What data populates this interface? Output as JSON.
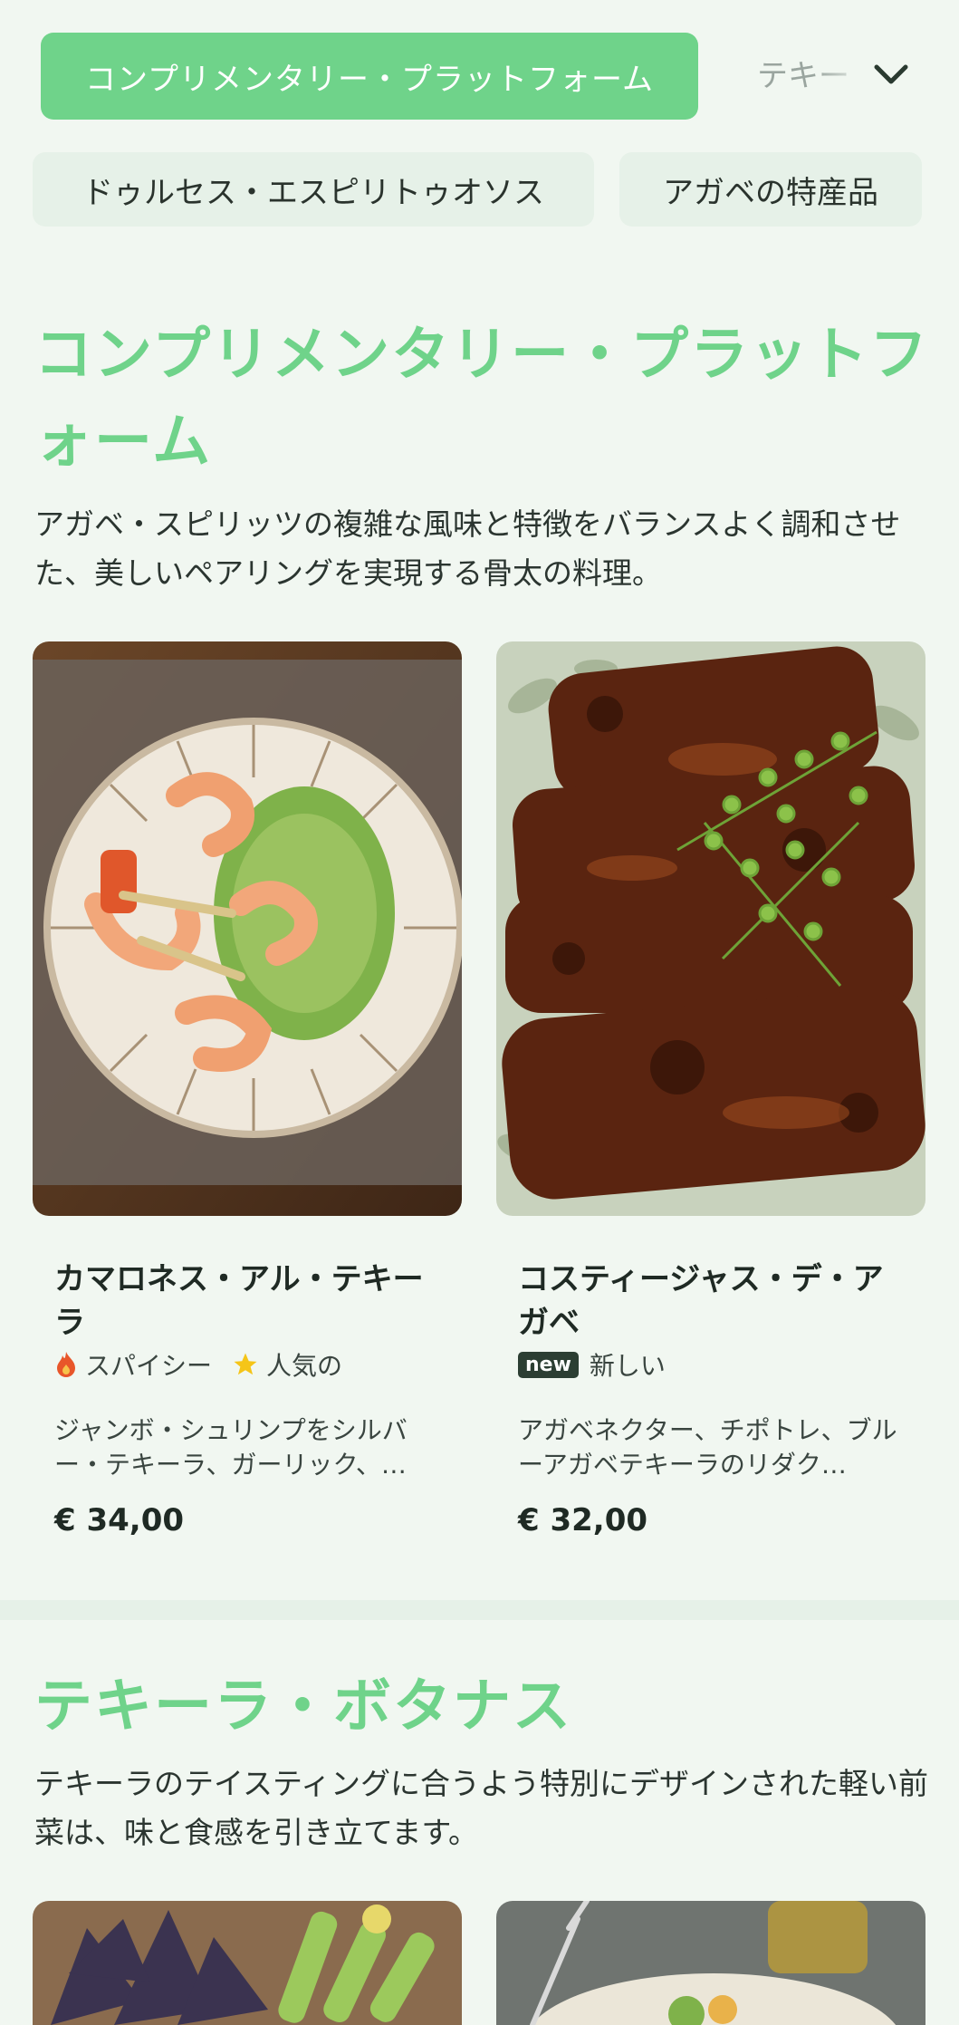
{
  "nav": {
    "active": "コンプリメンタリー・プラットフォーム",
    "next": "テキーラ",
    "chips": [
      "ドゥルセス・エスピリトゥオソス",
      "アガベの特産品"
    ]
  },
  "sections": [
    {
      "title": "コンプリメンタリー・プラットフォーム",
      "desc": "アガベ・スピリッツの複雑な風味と特徴をバランスよく調和させた、美しいペアリングを実現する骨太の料理。",
      "items": [
        {
          "name": "カマロネス・アル・テキーラ",
          "tags": [
            "スパイシー",
            "人気の"
          ],
          "desc": "ジャンボ・シュリンプをシルバー・テキーラ、ガーリック、…",
          "price": "€ 34,00"
        },
        {
          "name": "コスティージャス・デ・アガベ",
          "badge": "new",
          "tags": [
            "新しい"
          ],
          "desc": "アガベネクター、チポトレ、ブルーアガベテキーラのリダク…",
          "price": "€ 32,00"
        }
      ]
    },
    {
      "title": "テキーラ・ボタナス",
      "desc": "テキーラのテイスティングに合うよう特別にデザインされた軽い前菜は、味と食感を引き立てます。"
    }
  ],
  "colors": {
    "accent": "#6fd38a",
    "background": "#f1f7f1",
    "badge": "#2c3e33"
  }
}
